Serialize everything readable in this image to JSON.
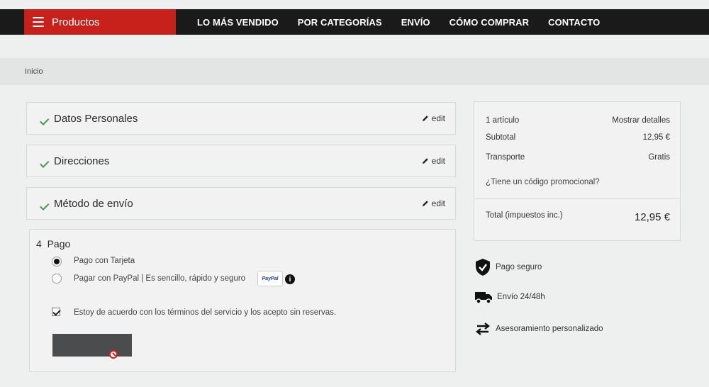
{
  "header": {
    "menu_label": "Productos",
    "nav": [
      "LO MÁS VENDIDO",
      "POR CATEGORÍAS",
      "ENVÍO",
      "CÓMO COMPRAR",
      "CONTACTO"
    ]
  },
  "breadcrumb": "Inicio",
  "checkout": {
    "steps": [
      {
        "title": "Datos Personales",
        "edit": "edit"
      },
      {
        "title": "Direcciones",
        "edit": "edit"
      },
      {
        "title": "Método de envío",
        "edit": "edit"
      }
    ],
    "payment": {
      "number": "4",
      "title": "Pago",
      "option_card": "Pago con Tarjeta",
      "option_paypal": "Pagar con PayPal | Es sencillo, rápido y seguro",
      "paypal_badge": "PayPal",
      "info_icon": "i",
      "terms": "Estoy de acuerdo con los términos del servicio y los acepto sin reservas."
    }
  },
  "summary": {
    "items_count": "1 artículo",
    "show_details": "Mostrar detalles",
    "subtotal_label": "Subtotal",
    "subtotal_value": "12,95 €",
    "shipping_label": "Transporte",
    "shipping_value": "Gratis",
    "promo": "¿Tiene un código promocional?",
    "total_label": "Total (impuestos inc.)",
    "total_value": "12,95 €"
  },
  "features": [
    "Pago seguro",
    "Envío 24/48h",
    "Asesoramiento personalizado"
  ],
  "colors": {
    "brand": "#c8201a",
    "nav_bg": "#1a1a1a",
    "check": "#4c9a58"
  }
}
